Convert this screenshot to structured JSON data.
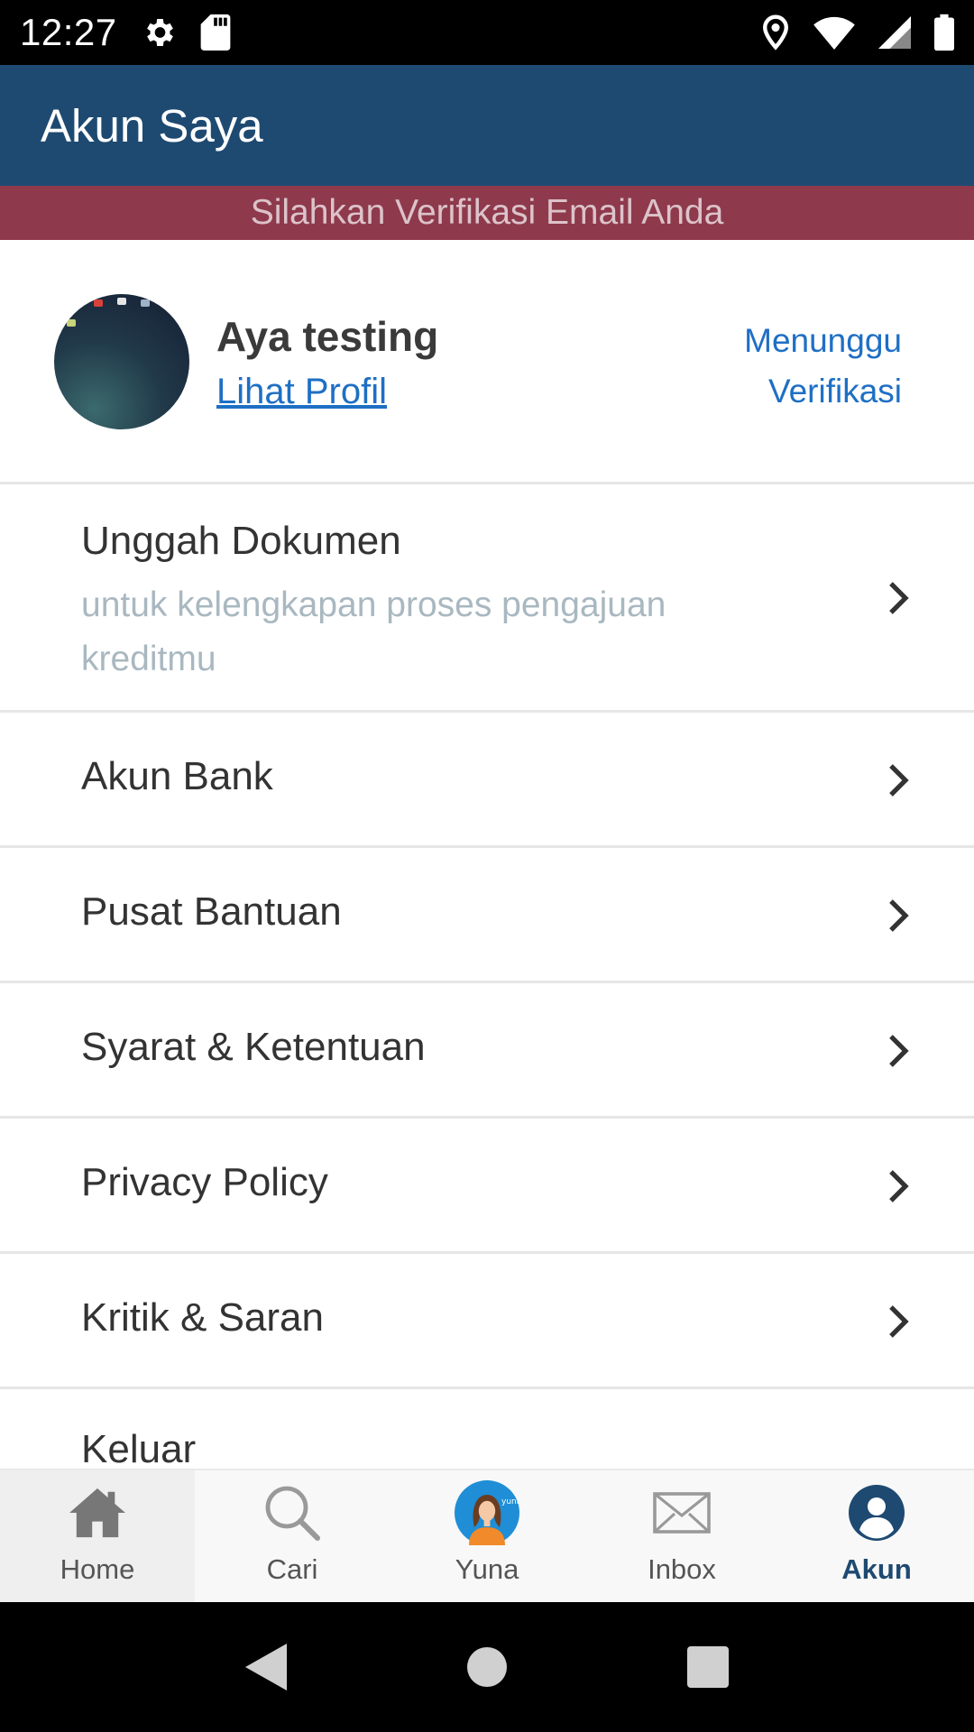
{
  "status_bar": {
    "time": "12:27"
  },
  "app_bar": {
    "title": "Akun Saya"
  },
  "banner": {
    "text": "Silahkan Verifikasi Email Anda"
  },
  "profile": {
    "name": "Aya testing",
    "link": "Lihat Profil",
    "status_line1": "Menunggu",
    "status_line2": "Verifikasi"
  },
  "menu": {
    "items": [
      {
        "label": "Unggah Dokumen",
        "sub_line1": "untuk kelengkapan proses pengajuan",
        "sub_line2": "kreditmu"
      },
      {
        "label": "Akun Bank"
      },
      {
        "label": "Pusat Bantuan"
      },
      {
        "label": "Syarat & Ketentuan"
      },
      {
        "label": "Privacy Policy"
      },
      {
        "label": "Kritik & Saran"
      },
      {
        "label": "Keluar"
      }
    ]
  },
  "bottom_nav": {
    "tabs": [
      {
        "label": "Home",
        "icon": "home-icon"
      },
      {
        "label": "Cari",
        "icon": "search-icon"
      },
      {
        "label": "Yuna",
        "icon": "yuna-avatar-icon"
      },
      {
        "label": "Inbox",
        "icon": "envelope-icon"
      },
      {
        "label": "Akun",
        "icon": "account-icon"
      }
    ],
    "active": "Akun"
  },
  "colors": {
    "app_bar": "#1e4a72",
    "banner": "#8e3a4c",
    "banner_text": "#dcc3ca",
    "link": "#1e6fc4",
    "subtitle": "#a9b8c0"
  }
}
